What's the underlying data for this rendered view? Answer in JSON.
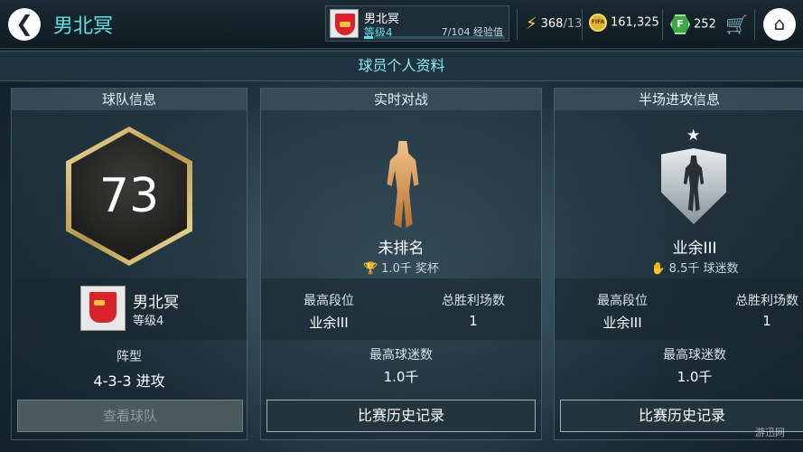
{
  "header": {
    "back_symbol": "❮",
    "title": "男北冥",
    "profile": {
      "name": "男北冥",
      "level": "等级4",
      "xp_current": "7",
      "xp_total": "/104",
      "xp_label": "经验值",
      "xp_progress": 0.067
    },
    "energy": {
      "value": "368",
      "max": "/13"
    },
    "coins": "161,325",
    "points": "252",
    "home_symbol": "⌂"
  },
  "section_title": "球员个人资料",
  "team_card": {
    "title": "球队信息",
    "rating": "73",
    "club_name": "男北冥",
    "club_level": "等级4",
    "formation_label": "阵型",
    "formation_value": "4-3-3 进攻",
    "view_button": "查看球队"
  },
  "live_card": {
    "title": "实时对战",
    "rank": "未排名",
    "sub_value": "1.0千",
    "sub_label": "奖杯",
    "best_division_label": "最高段位",
    "best_division_value": "业余III",
    "total_wins_label": "总胜利场数",
    "total_wins_value": "1",
    "max_fans_label": "最高球迷数",
    "max_fans_value": "1.0千",
    "history_button": "比赛历史记录"
  },
  "attack_card": {
    "title": "半场进攻信息",
    "rank": "业余III",
    "sub_value": "8.5千",
    "sub_label": "球迷数",
    "best_division_label": "最高段位",
    "best_division_value": "业余III",
    "total_wins_label": "总胜利场数",
    "total_wins_value": "1",
    "max_fans_label": "最高球迷数",
    "max_fans_value": "1.0千",
    "history_button": "比赛历史记录"
  },
  "watermark": "游迅网"
}
